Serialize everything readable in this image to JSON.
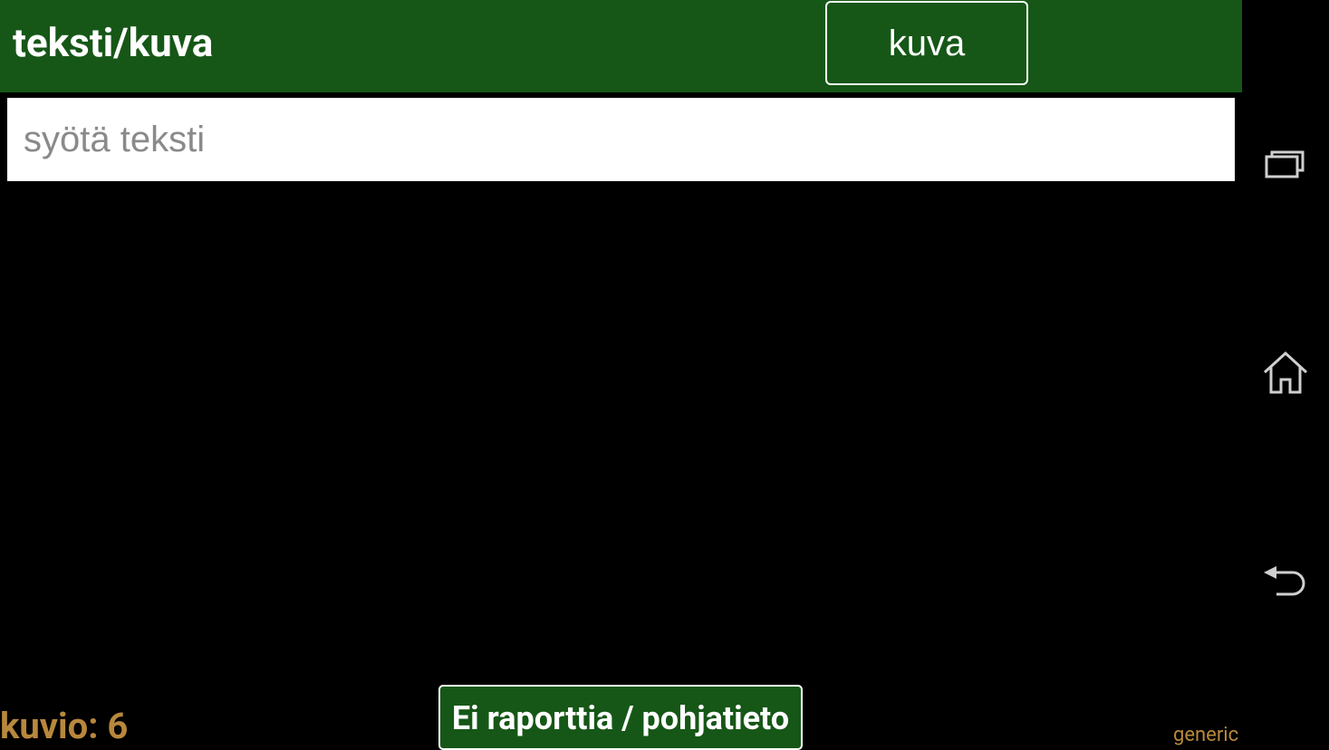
{
  "header": {
    "title": "teksti/kuva",
    "toggle_label": "kuva",
    "background_color": "#165717"
  },
  "input": {
    "placeholder": "syötä teksti",
    "value": ""
  },
  "footer": {
    "count_label": "kuvio: 6",
    "report_button_label": "Ei raporttia / pohjatieto",
    "mode_label": "generic",
    "accent_color": "#b8883c"
  },
  "navbar": {
    "buttons": [
      {
        "icon": "recent-apps-icon"
      },
      {
        "icon": "home-icon"
      },
      {
        "icon": "back-icon"
      }
    ]
  }
}
